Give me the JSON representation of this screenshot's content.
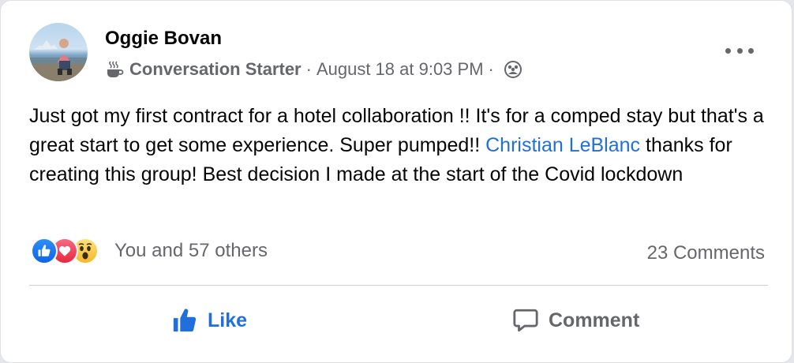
{
  "post": {
    "author": "Oggie Bovan",
    "badge": "Conversation Starter",
    "separator": "·",
    "timestamp": "August 18 at 9:03 PM",
    "text_before": "Just got my first contract for a hotel collaboration !! It's for a comped stay but that's a great start to get some experience. Super pumped!! ",
    "mention": "Christian LeBlanc",
    "text_after": " thanks for creating this group! Best decision I made at the start of the Covid lockdown"
  },
  "reactions": {
    "icons": [
      "like-reaction-icon",
      "love-reaction-icon",
      "wow-reaction-icon"
    ],
    "summary": "You and 57 others"
  },
  "comments": {
    "count_label": "23 Comments"
  },
  "actions": {
    "like_label": "Like",
    "comment_label": "Comment"
  },
  "colors": {
    "accent": "#216fdb",
    "muted": "#65676b",
    "text": "#050505"
  }
}
